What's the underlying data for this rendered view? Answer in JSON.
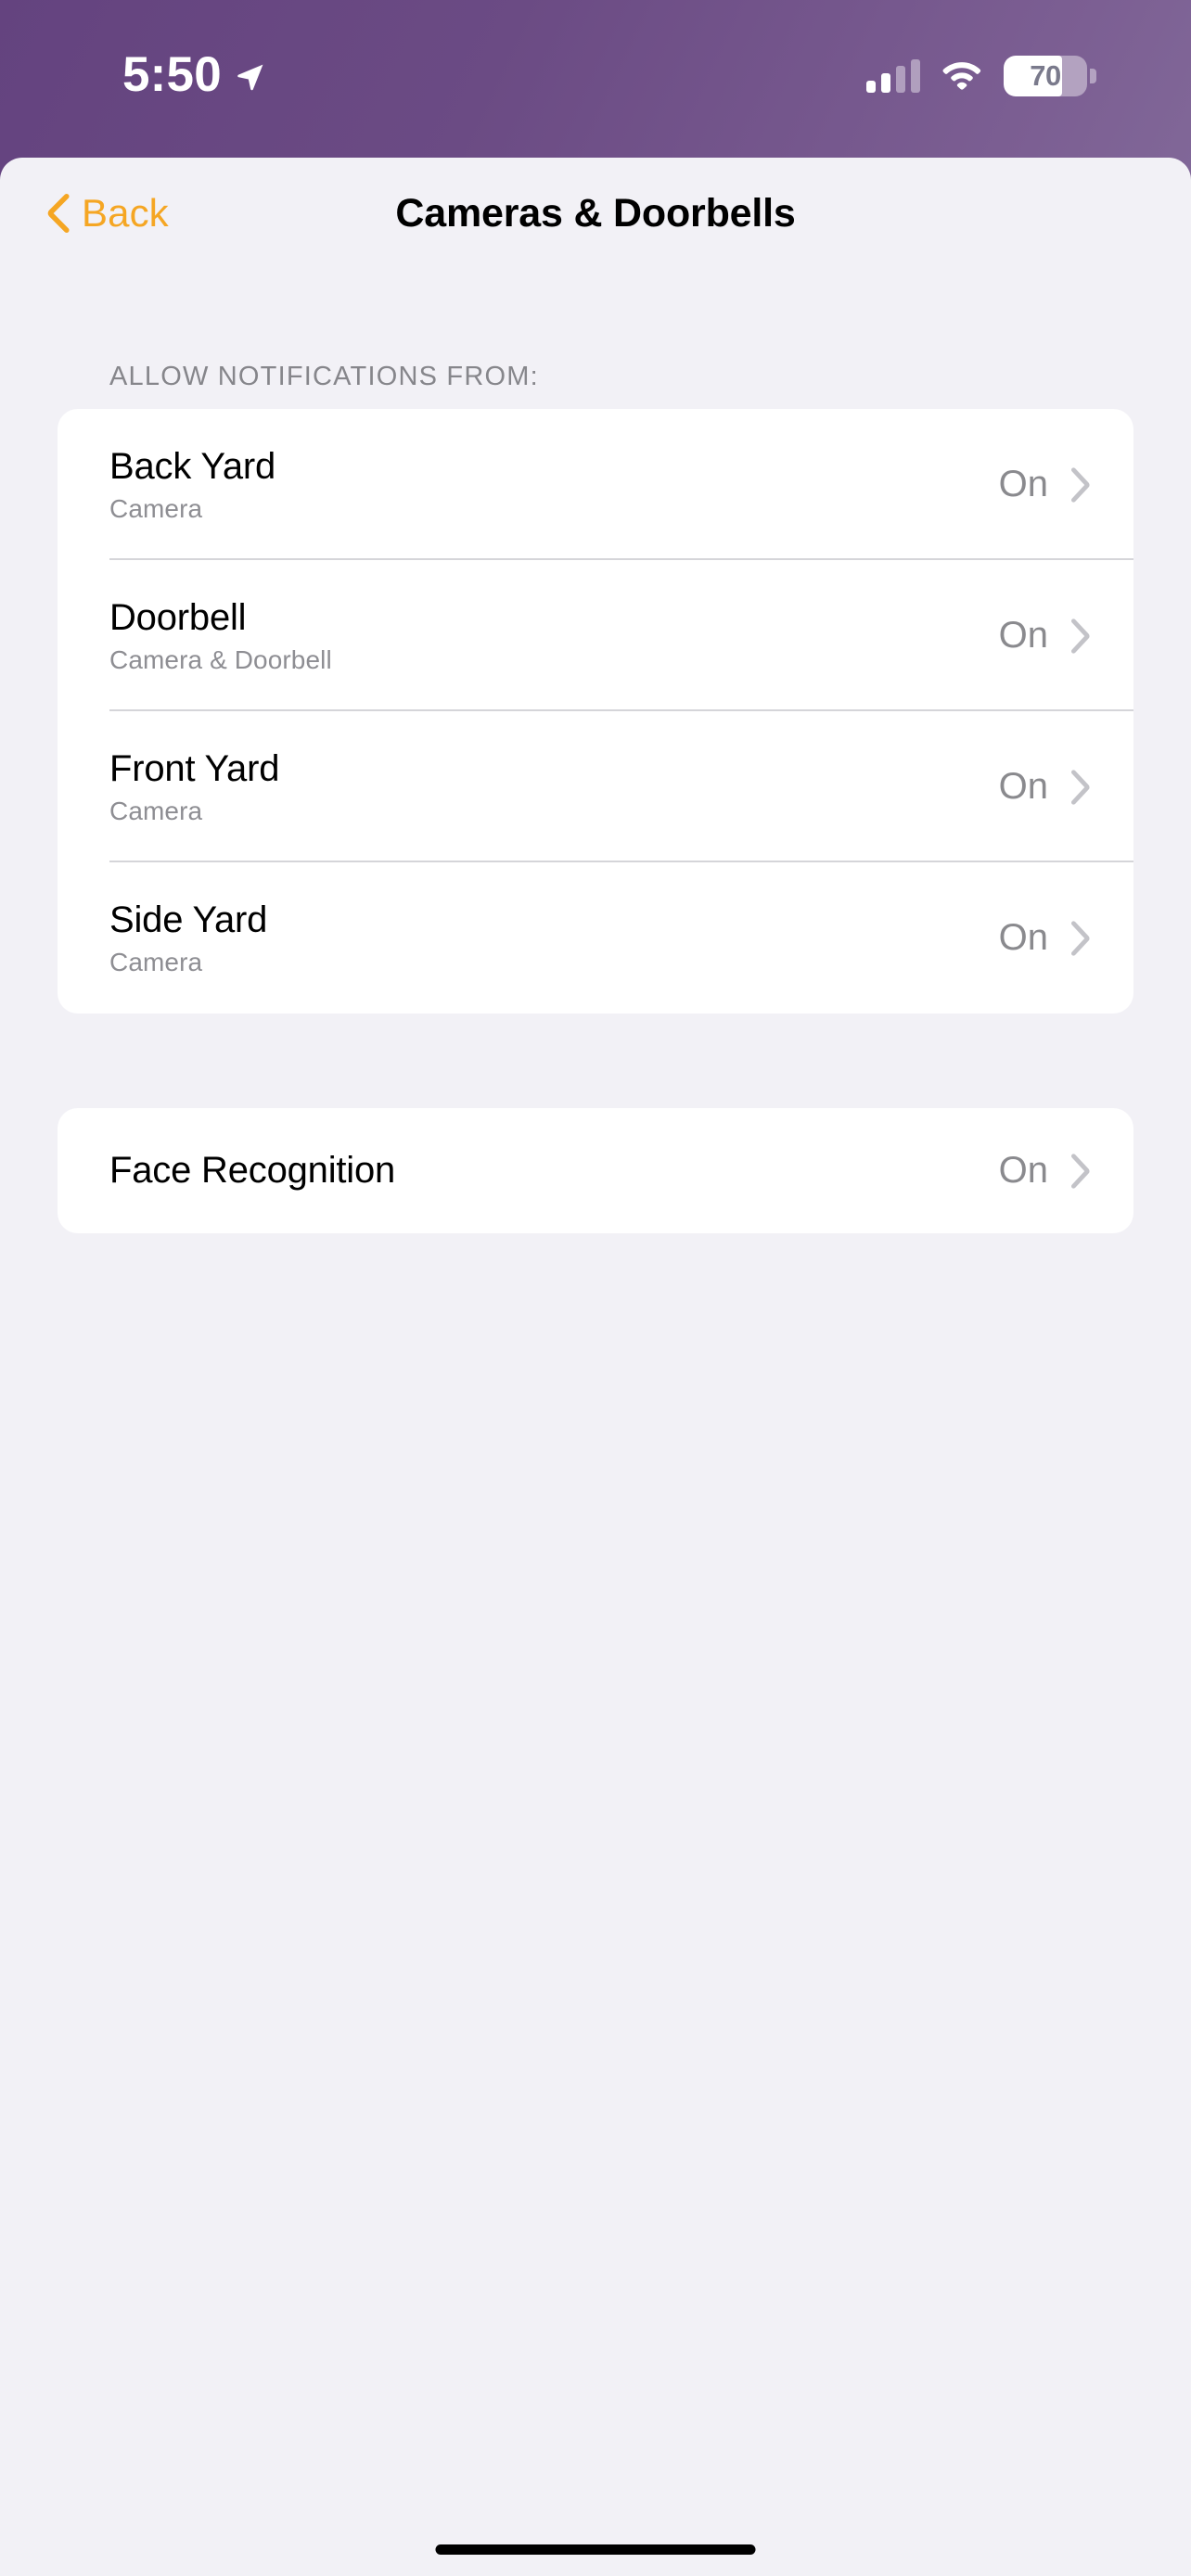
{
  "status_bar": {
    "time": "5:50",
    "location_icon": "location-arrow-icon",
    "cellular_icon": "cellular-signal-icon",
    "cellular_bars_total": 4,
    "cellular_bars_active": 2,
    "wifi_icon": "wifi-icon",
    "battery_icon": "battery-icon",
    "battery_level": "70",
    "battery_percent": 70
  },
  "nav": {
    "back_label": "Back",
    "back_icon": "chevron-left-icon",
    "title": "Cameras & Doorbells"
  },
  "sections": [
    {
      "header": "ALLOW NOTIFICATIONS FROM:",
      "rows": [
        {
          "title": "Back Yard",
          "subtitle": "Camera",
          "value": "On",
          "accessory": "chevron-right-icon"
        },
        {
          "title": "Doorbell",
          "subtitle": "Camera & Doorbell",
          "value": "On",
          "accessory": "chevron-right-icon"
        },
        {
          "title": "Front Yard",
          "subtitle": "Camera",
          "value": "On",
          "accessory": "chevron-right-icon"
        },
        {
          "title": "Side Yard",
          "subtitle": "Camera",
          "value": "On",
          "accessory": "chevron-right-icon"
        }
      ]
    },
    {
      "header": "",
      "rows": [
        {
          "title": "Face Recognition",
          "subtitle": "",
          "value": "On",
          "accessory": "chevron-right-icon"
        }
      ]
    }
  ],
  "colors": {
    "accent": "#f5a623",
    "sheet_background": "#f2f1f6",
    "card_background": "#ffffff",
    "primary_text": "#000000",
    "secondary_text": "#8e8e93",
    "separator": "#d5d5d9",
    "gradient_start": "#64437f",
    "gradient_end": "#9a9cb0"
  },
  "home_indicator": "home-indicator"
}
